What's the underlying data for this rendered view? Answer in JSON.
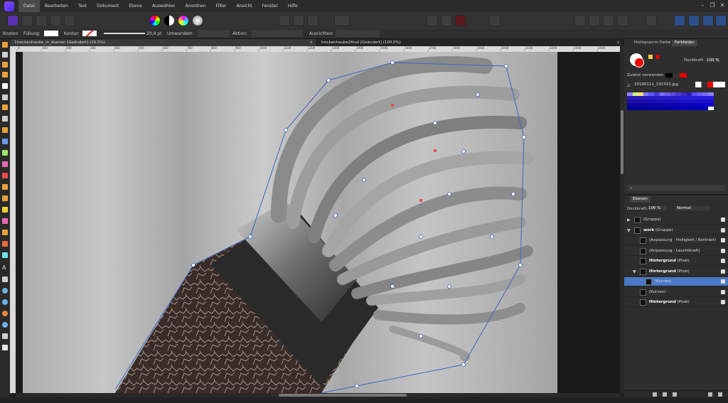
{
  "app": {
    "name": "Affinity Photo"
  },
  "menu": [
    "Datei",
    "Bearbeiten",
    "Text",
    "Dokument",
    "Ebene",
    "Auswählen",
    "Anordnen",
    "Filter",
    "Ansicht",
    "Fenster",
    "Hilfe"
  ],
  "context": {
    "node_label": "Knoten",
    "fill_label": "Füllung:",
    "stroke_label": "Kontur:",
    "stroke_width": "20,9 pt",
    "convert_label": "Umwandeln:",
    "action_label": "Aktion:",
    "align_label": "Ausrichten:"
  },
  "tabs": [
    {
      "title": "1trockenhaube_in_duenen [Geändert] (26.5%)",
      "close": "×"
    },
    {
      "title": "trockenhaube2final [Geändert] (100.0%)",
      "close": "×"
    }
  ],
  "ruler_marks": [
    "0",
    "100",
    "200",
    "300",
    "400",
    "500",
    "600",
    "700",
    "800",
    "900",
    "1000",
    "1100",
    "1200",
    "1300",
    "1400",
    "1500",
    "1600",
    "1700",
    "1800",
    "1900",
    "2000",
    "2100",
    "2200",
    "2300",
    "2400"
  ],
  "color_panel": {
    "tabs": [
      "Histogramm",
      "Farbe",
      "Farbfelder"
    ],
    "opacity_label": "Deckkraft:",
    "opacity_value": "100 %",
    "recent_label": "Zuletzt verwendet:",
    "palette_file": "20190111_191910.jpg"
  },
  "layers_panel": {
    "tab": "Ebenen",
    "opacity_label": "Deckkraft:",
    "opacity_value": "100 %",
    "blend_mode": "Normal",
    "rows": [
      {
        "name": "(Gruppe)",
        "bold": "",
        "indent": 0,
        "expand": "▶",
        "selected": false
      },
      {
        "name": " (Gruppe)",
        "bold": "work",
        "indent": 0,
        "expand": "▼",
        "selected": false
      },
      {
        "name": "(Anpassung - Helligkeit / Kontrast)",
        "bold": "",
        "indent": 1,
        "expand": "",
        "selected": false
      },
      {
        "name": "(Anpassung - Leuchtkraft)",
        "bold": "",
        "indent": 1,
        "expand": "",
        "selected": false
      },
      {
        "name": " (Pixel)",
        "bold": "Hintergrund",
        "indent": 1,
        "expand": "",
        "selected": false
      },
      {
        "name": " (Pixel)",
        "bold": "Hintergrund",
        "indent": 1,
        "expand": "▼",
        "selected": false
      },
      {
        "name": "(Kurven)",
        "bold": "",
        "indent": 2,
        "expand": "",
        "selected": true
      },
      {
        "name": "(Kurven)",
        "bold": "",
        "indent": 1,
        "expand": "",
        "selected": false
      },
      {
        "name": " (Pixel)",
        "bold": "Hintergrund",
        "indent": 1,
        "expand": "",
        "selected": false
      }
    ]
  },
  "colors": {
    "accent": "#4a79c7",
    "brand": "#7b4cff",
    "red": "#e00000"
  }
}
